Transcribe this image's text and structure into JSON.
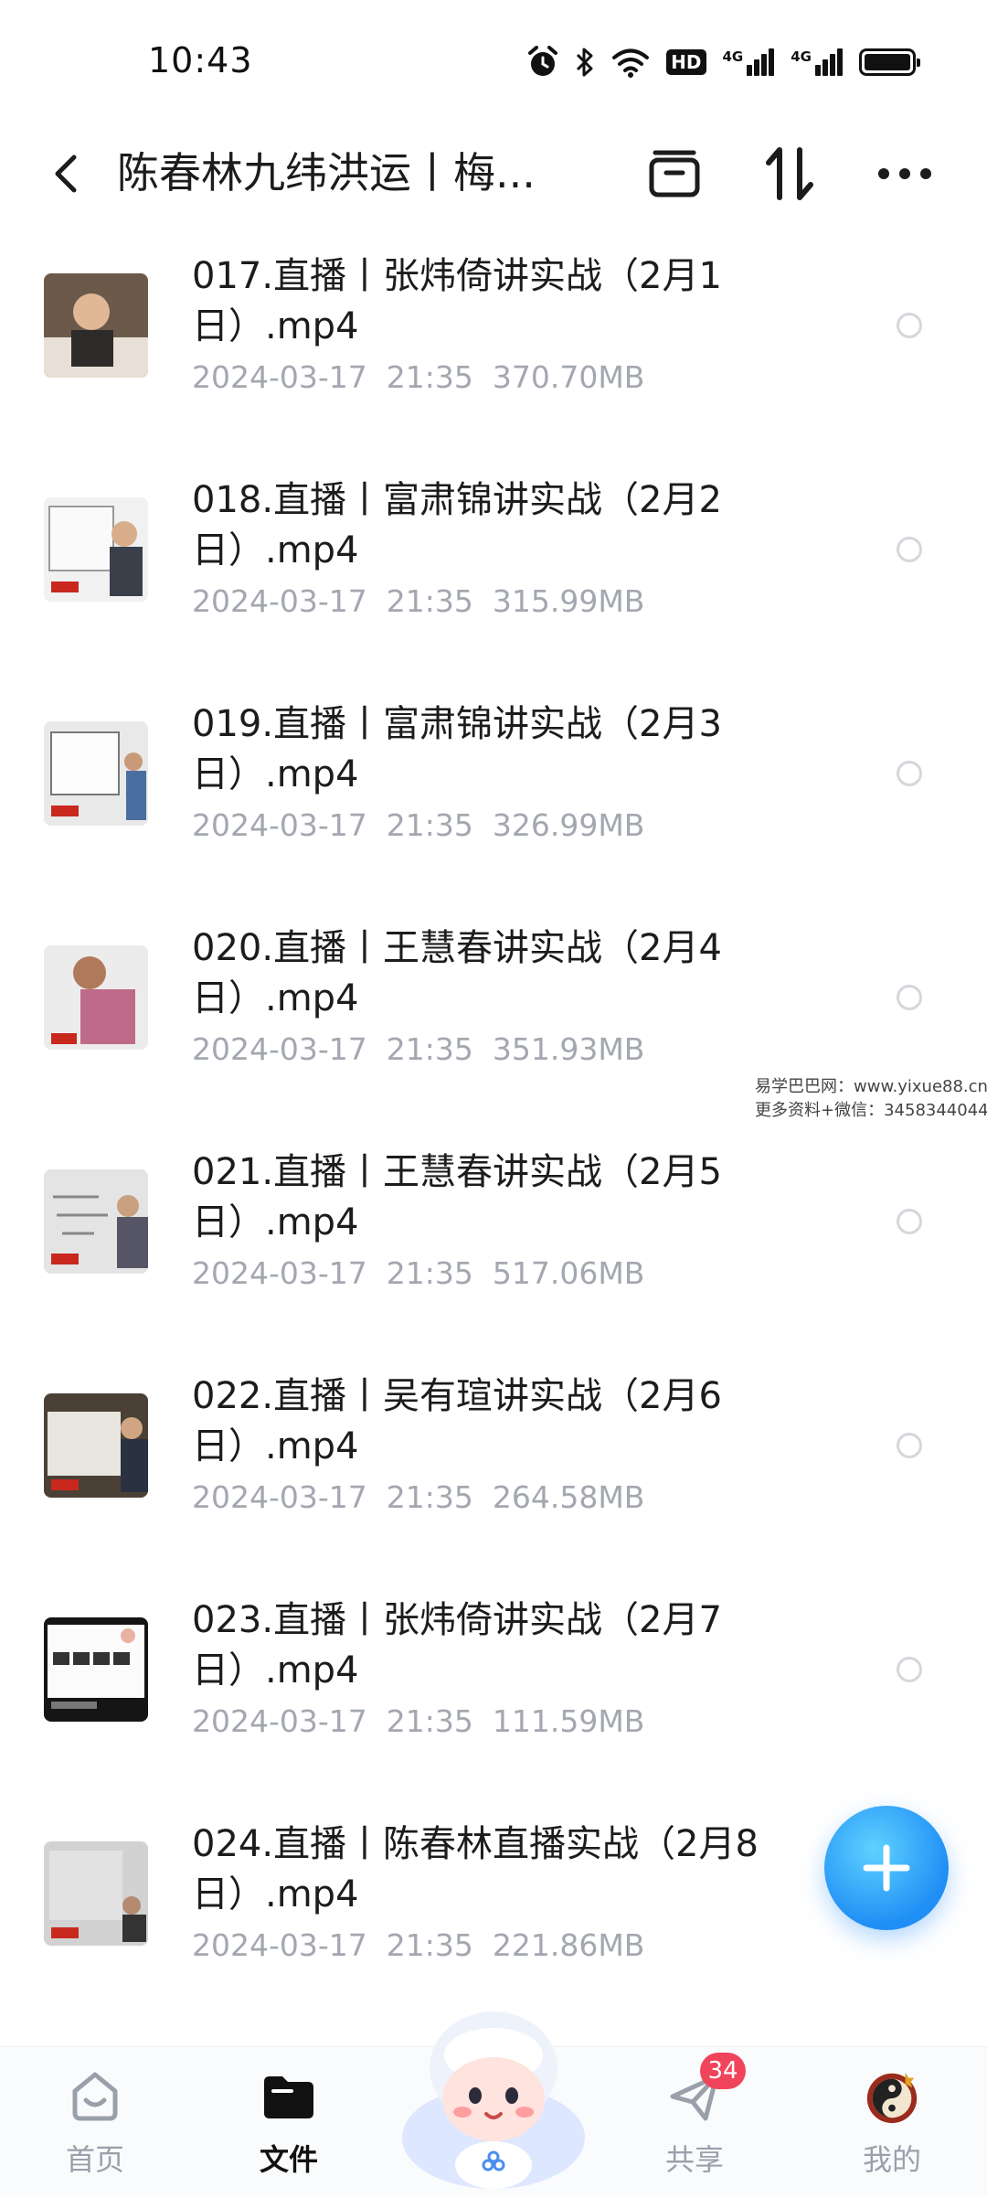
{
  "status": {
    "time": "10:43",
    "hd": "HD",
    "net1": "4G",
    "net2": "4G"
  },
  "header": {
    "title": "陈春林九纬洪运丨梅..."
  },
  "files": [
    {
      "name": "017.直播丨张炜倚讲实战（2月1日）.mp4",
      "date": "2024-03-17",
      "time": "21:35",
      "size": "370.70MB"
    },
    {
      "name": "018.直播丨富肃锦讲实战（2月2日）.mp4",
      "date": "2024-03-17",
      "time": "21:35",
      "size": "315.99MB"
    },
    {
      "name": "019.直播丨富肃锦讲实战（2月3日）.mp4",
      "date": "2024-03-17",
      "time": "21:35",
      "size": "326.99MB"
    },
    {
      "name": "020.直播丨王慧春讲实战（2月4日）.mp4",
      "date": "2024-03-17",
      "time": "21:35",
      "size": "351.93MB"
    },
    {
      "name": "021.直播丨王慧春讲实战（2月5日）.mp4",
      "date": "2024-03-17",
      "time": "21:35",
      "size": "517.06MB"
    },
    {
      "name": "022.直播丨吴有瑄讲实战（2月6日）.mp4",
      "date": "2024-03-17",
      "time": "21:35",
      "size": "264.58MB"
    },
    {
      "name": "023.直播丨张炜倚讲实战（2月7日）.mp4",
      "date": "2024-03-17",
      "time": "21:35",
      "size": "111.59MB"
    },
    {
      "name": "024.直播丨陈春林直播实战（2月8日）.mp4",
      "date": "2024-03-17",
      "time": "21:35",
      "size": "221.86MB"
    }
  ],
  "watermark": {
    "line1": "易学巴巴网：www.yixue88.cn",
    "line2": "更多资料+微信：3458344044"
  },
  "nav": {
    "home": "首页",
    "files": "文件",
    "share": "共享",
    "share_badge": "34",
    "mine": "我的"
  },
  "colors": {
    "accent": "#1f8ef5",
    "badge": "#f0445a",
    "meta_text": "#a3a7b0"
  }
}
